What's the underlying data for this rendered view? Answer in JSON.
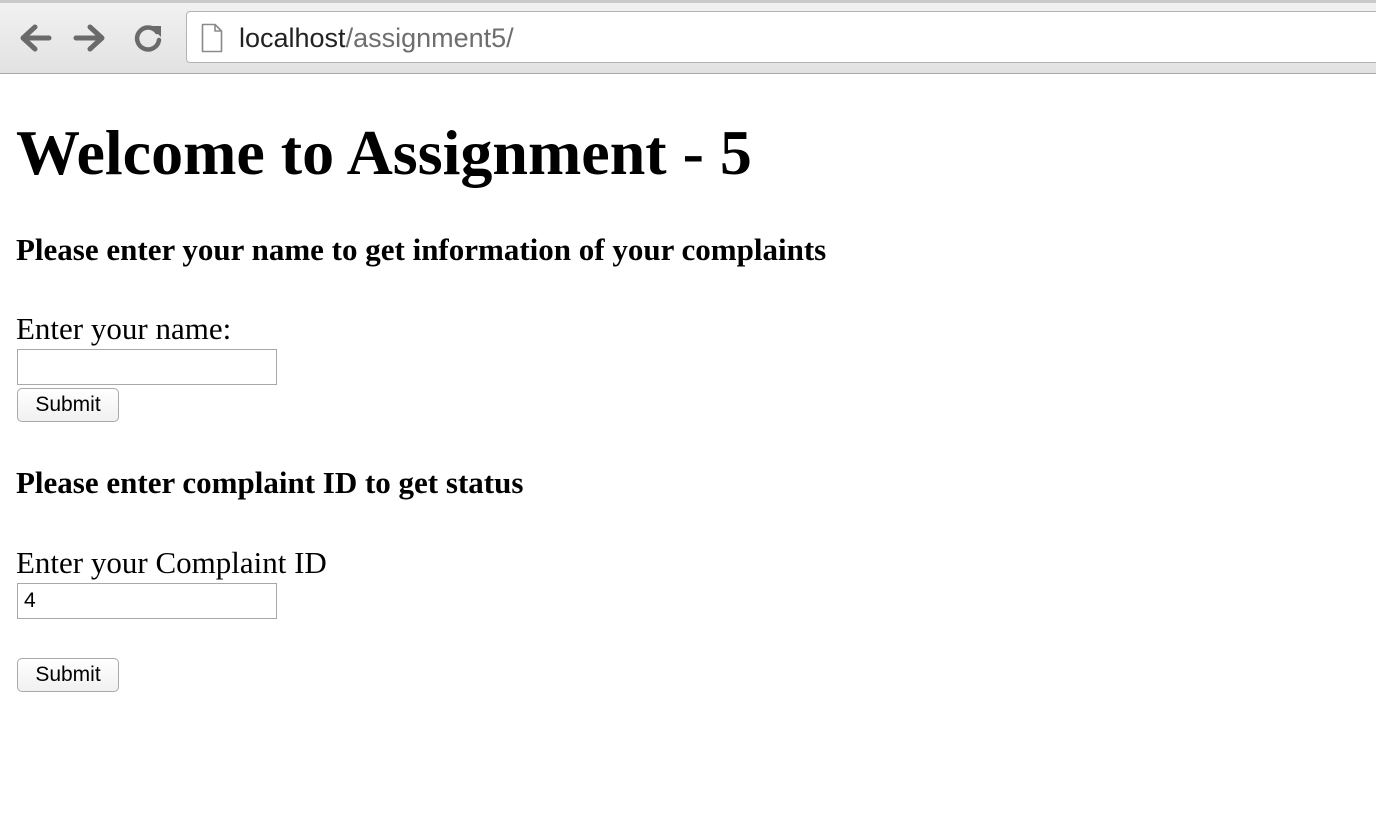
{
  "browser": {
    "url_host": "localhost",
    "url_path": "/assignment5/",
    "back_icon": "arrow-left-icon",
    "forward_icon": "arrow-right-icon",
    "reload_icon": "reload-icon",
    "page_icon": "document-icon"
  },
  "page": {
    "title": "Welcome to Assignment - 5",
    "name_form": {
      "heading": "Please enter your name to get information of your complaints",
      "label": "Enter your name:",
      "input_value": "",
      "submit_label": "Submit"
    },
    "complaint_form": {
      "heading": "Please enter complaint ID to get status",
      "label": "Enter your Complaint ID",
      "input_value": "4",
      "submit_label": "Submit"
    }
  }
}
